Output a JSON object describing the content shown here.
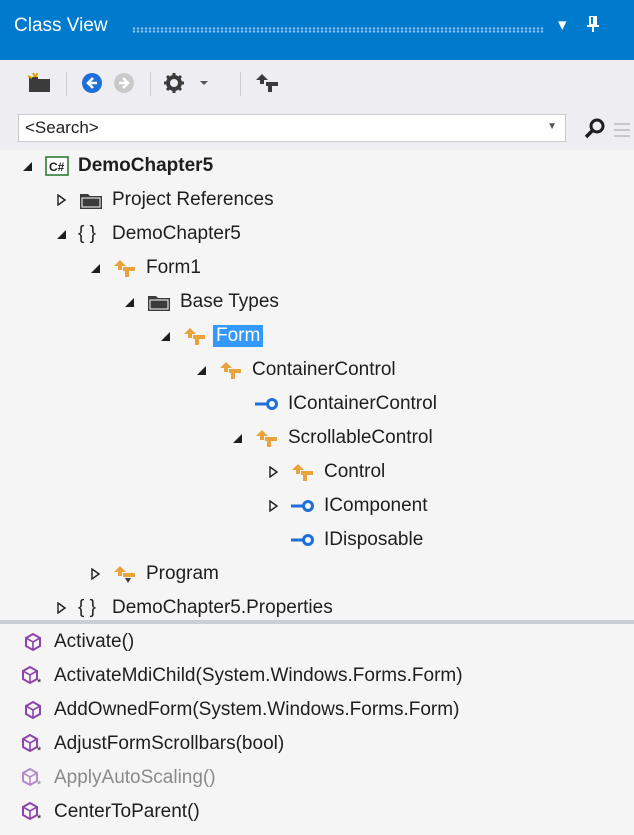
{
  "window": {
    "title": "Class View"
  },
  "search": {
    "value": "<Search>"
  },
  "tree": [
    {
      "label": "DemoChapter5",
      "bold": true
    },
    {
      "label": "Project References"
    },
    {
      "label": "{ }"
    },
    {
      "label": "DemoChapter5"
    },
    {
      "label": "Form1"
    },
    {
      "label": "Base Types"
    },
    {
      "label": "Form",
      "selected": true
    },
    {
      "label": "ContainerControl"
    },
    {
      "label": "IContainerControl"
    },
    {
      "label": "ScrollableControl"
    },
    {
      "label": "Control"
    },
    {
      "label": "IComponent"
    },
    {
      "label": "IDisposable"
    },
    {
      "label": "Program"
    },
    {
      "label": "{ }"
    },
    {
      "label": "DemoChapter5.Properties"
    }
  ],
  "members": [
    {
      "label": "Activate()"
    },
    {
      "label": "ActivateMdiChild(System.Windows.Forms.Form)"
    },
    {
      "label": "AddOwnedForm(System.Windows.Forms.Form)"
    },
    {
      "label": "AdjustFormScrollbars(bool)"
    },
    {
      "label": "ApplyAutoScaling()"
    },
    {
      "label": "CenterToParent()"
    }
  ],
  "colors": {
    "accent": "#007acc",
    "selection": "#3399ff",
    "class_icon": "#e8a33d",
    "interface_icon": "#1e6fd9",
    "method_icon": "#8e44ad"
  }
}
